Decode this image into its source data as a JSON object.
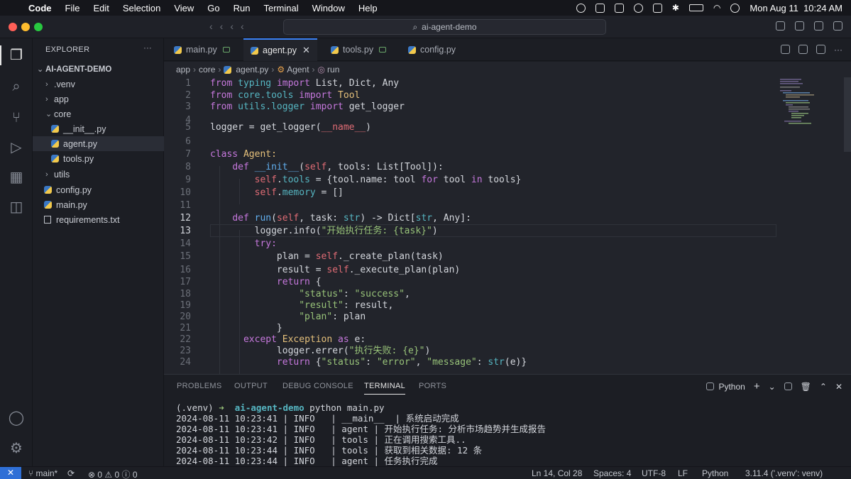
{
  "menubar": {
    "app": "Code",
    "items": [
      "File",
      "Edit",
      "Selection",
      "View",
      "Go",
      "Run",
      "Terminal",
      "Window",
      "Help"
    ],
    "datetime": "Mon Aug 11  10:24 AM"
  },
  "titlebar": {
    "search": "ai-agent-demo"
  },
  "explorer": {
    "title": "EXPLORER",
    "root": "AI-AGENT-DEMO",
    "items": [
      ".venv",
      "app",
      "core",
      "__init__.py",
      "agent.py",
      "tools.py",
      "utils",
      "config.py",
      "main.py",
      "requirements.txt"
    ]
  },
  "tabs": [
    "main.py",
    "agent.py",
    "tools.py",
    "config.py"
  ],
  "breadcrumb": [
    "app",
    "core",
    "agent.py",
    "Agent",
    "run"
  ],
  "code": {
    "line_numbers": [
      "1",
      "2",
      "3",
      "4",
      "5",
      "6",
      "7",
      "8",
      "9",
      "10",
      "11",
      "12",
      "13",
      "14",
      "15",
      "16",
      "17",
      "18",
      "19",
      "20",
      "21",
      "22",
      "23",
      "24"
    ],
    "l1": [
      "from",
      "typing",
      "import",
      "List, Dict, Any"
    ],
    "l2": [
      "from",
      "core.tools",
      "import",
      "Tool"
    ],
    "l3": [
      "from",
      "utils.logger",
      "import",
      "get_logger"
    ],
    "l5": [
      "logger = get_logger(",
      "__name__",
      ")"
    ],
    "l7": [
      "class",
      "Agent:"
    ],
    "l8": [
      "def",
      "__init__",
      "(",
      "self",
      ", tools: List[Tool]):"
    ],
    "l9": [
      "self",
      ".",
      "tools",
      " = {tool.name: tool ",
      "for",
      " tool ",
      "in",
      " tools}"
    ],
    "l10": [
      "self",
      ".",
      "memory",
      " = []"
    ],
    "l13": [
      "def",
      "run",
      "(",
      "self",
      ", task: ",
      "str",
      ") -> Dict[",
      "str",
      ", Any]:"
    ],
    "l14": [
      "logger.info(",
      "\"开始执行任务: {task}\"",
      ")"
    ],
    "l15": [
      "try:"
    ],
    "l16": [
      "plan = ",
      "self",
      "._create_plan(task)"
    ],
    "l17": [
      "result = ",
      "self",
      "._execute_plan(plan)"
    ],
    "l18": [
      "return",
      "{"
    ],
    "l19": [
      "\"status\"",
      ": ",
      "\"success\"",
      ","
    ],
    "l20": [
      "\"result\"",
      ": result,"
    ],
    "l21": [
      "\"plan\"",
      ": plan"
    ],
    "l22": [
      "}"
    ],
    "l23": [
      "except",
      "Exception",
      "as",
      "e:"
    ],
    "l24": [
      "logger.errer(",
      "\"执行失败: {e}\"",
      ")"
    ],
    "l25": [
      "return",
      "{",
      "\"status\"",
      ": ",
      "\"error\"",
      ", ",
      "\"message\"",
      ": ",
      "str",
      "(e)}"
    ]
  },
  "panel": {
    "tabs": [
      "PROBLEMS",
      "OUTPUT",
      "DEBUG CONSOLE",
      "TERMINAL",
      "PORTS"
    ],
    "shell": "Python",
    "terminal": [
      "(.venv) ➜  ai-agent-demo python main.py",
      "2024-08-11 10:23:41 | INFO   | __main__  | 系统启动完成",
      "2024-08-11 10:23:41 | INFO   | agent | 开始执行任务: 分析市场趋势并生成报告",
      "2024-08-11 10:23:42 | INFO   | tools | 正在调用搜索工具..",
      "2024-08-11 10:23:44 | INFO   | tools | 获取到相关数据: 12 条",
      "2024-08-11 10:23:44 | INFO   | agent | 任务执行完成"
    ]
  },
  "status": {
    "branch": "main*",
    "errors": "0",
    "warnings": "0",
    "info": "0",
    "position": "Ln 14, Col 28",
    "spaces": "Spaces: 4",
    "encoding": "UTF-8",
    "eol": "LF",
    "language": "Python",
    "interpreter": "3.11.4 ('.venv': venv)"
  }
}
